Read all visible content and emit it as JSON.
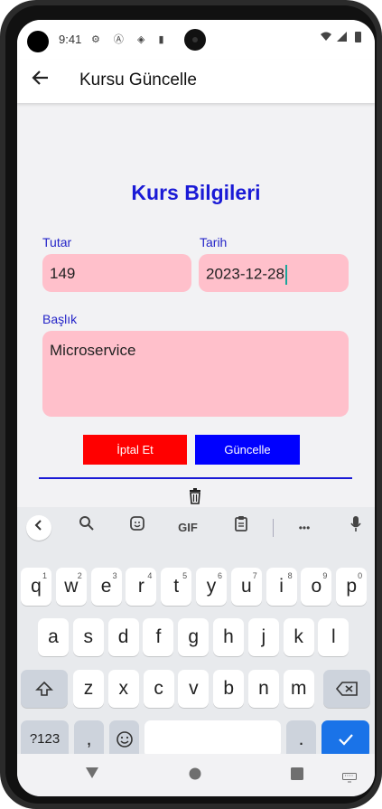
{
  "status": {
    "time": "9:41",
    "icons_left": "⚙ Ⓐ ◈ ▮",
    "icons_right": "▾◢▮"
  },
  "appbar": {
    "title": "Kursu Güncelle"
  },
  "form": {
    "heading": "Kurs Bilgileri",
    "amount_label": "Tutar",
    "amount_value": "149",
    "date_label": "Tarih",
    "date_value": "2023-12-28",
    "title_label": "Başlık",
    "title_value": "Microservice",
    "cancel_label": "İptal Et",
    "update_label": "Güncelle"
  },
  "colors": {
    "accent": "#1a1ad6",
    "field_bg": "#ffc0cb",
    "cancel": "#ff0000",
    "update": "#0000ff"
  },
  "keyboard": {
    "toolbar": {
      "gif": "GIF",
      "more": "•••"
    },
    "row1": [
      {
        "k": "q",
        "s": "1"
      },
      {
        "k": "w",
        "s": "2"
      },
      {
        "k": "e",
        "s": "3"
      },
      {
        "k": "r",
        "s": "4"
      },
      {
        "k": "t",
        "s": "5"
      },
      {
        "k": "y",
        "s": "6"
      },
      {
        "k": "u",
        "s": "7"
      },
      {
        "k": "i",
        "s": "8"
      },
      {
        "k": "o",
        "s": "9"
      },
      {
        "k": "p",
        "s": "0"
      }
    ],
    "row2": [
      "a",
      "s",
      "d",
      "f",
      "g",
      "h",
      "j",
      "k",
      "l"
    ],
    "row3": [
      "z",
      "x",
      "c",
      "v",
      "b",
      "n",
      "m"
    ],
    "symbols": "?123",
    "comma": ",",
    "period": "."
  }
}
